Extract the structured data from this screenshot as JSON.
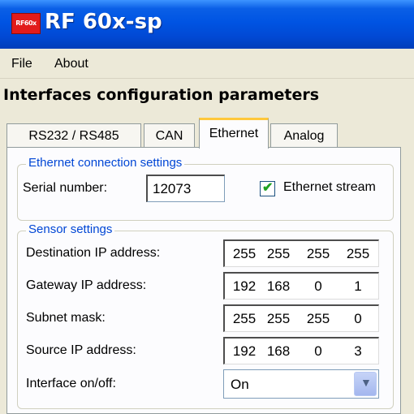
{
  "window": {
    "title": "RF 60x-sp",
    "icon_text": "RF60x"
  },
  "menu": {
    "items": [
      "File",
      "About"
    ]
  },
  "section_header": "Interfaces configuration parameters",
  "tabs": [
    {
      "label": "RS232 / RS485",
      "active": false
    },
    {
      "label": "CAN",
      "active": false
    },
    {
      "label": "Ethernet",
      "active": true
    },
    {
      "label": "Analog",
      "active": false
    }
  ],
  "ethernet_connection": {
    "legend": "Ethernet connection settings",
    "serial_label": "Serial number:",
    "serial_value": "12073",
    "stream_label": "Ethernet stream",
    "stream_checked": true
  },
  "sensor_settings": {
    "legend": "Sensor settings",
    "rows": [
      {
        "label": "Destination IP address:",
        "octets": [
          "255",
          "255",
          "255",
          "255"
        ]
      },
      {
        "label": "Gateway IP address:",
        "octets": [
          "192",
          "168",
          "0",
          "1"
        ]
      },
      {
        "label": "Subnet mask:",
        "octets": [
          "255",
          "255",
          "255",
          "0"
        ]
      },
      {
        "label": "Source IP address:",
        "octets": [
          "192",
          "168",
          "0",
          "3"
        ]
      }
    ],
    "interface_label": "Interface on/off:",
    "interface_value": "On"
  },
  "colors": {
    "titlebar": "#0054E3",
    "legend": "#0046D5",
    "active_tab_accent": "#FFC83C",
    "check": "#21A121"
  },
  "icons": {
    "dropdown": "chevron-down-icon",
    "check": "check-icon"
  }
}
